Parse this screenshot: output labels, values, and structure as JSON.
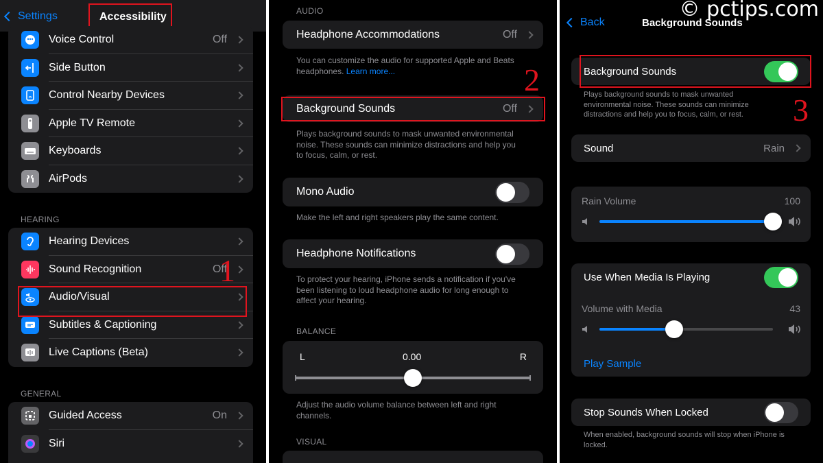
{
  "panel1": {
    "nav": {
      "back_label": "Settings",
      "title": "Accessibility"
    },
    "group_top": [
      {
        "label": "Voice Control",
        "value": "Off",
        "icon": "voice-control-icon",
        "color": "#0a84ff"
      },
      {
        "label": "Side Button",
        "value": "",
        "icon": "side-button-icon",
        "color": "#0a84ff"
      },
      {
        "label": "Control Nearby Devices",
        "value": "",
        "icon": "control-nearby-icon",
        "color": "#0a84ff"
      },
      {
        "label": "Apple TV Remote",
        "value": "",
        "icon": "tv-remote-icon",
        "color": "#8e8e93"
      },
      {
        "label": "Keyboards",
        "value": "",
        "icon": "keyboard-icon",
        "color": "#8e8e93"
      },
      {
        "label": "AirPods",
        "value": "",
        "icon": "airpods-icon",
        "color": "#8e8e93"
      }
    ],
    "hearing_header": "HEARING",
    "group_hearing": [
      {
        "label": "Hearing Devices",
        "value": "",
        "icon": "ear-icon",
        "color": "#0a84ff"
      },
      {
        "label": "Sound Recognition",
        "value": "Off",
        "icon": "sound-recognition-icon",
        "color": "#ff375f"
      },
      {
        "label": "Audio/Visual",
        "value": "",
        "icon": "audio-visual-icon",
        "color": "#0a84ff"
      },
      {
        "label": "Subtitles & Captioning",
        "value": "",
        "icon": "subtitles-icon",
        "color": "#0a84ff"
      },
      {
        "label": "Live Captions (Beta)",
        "value": "",
        "icon": "live-captions-icon",
        "color": "#8e8e93"
      }
    ],
    "general_header": "GENERAL",
    "group_general": [
      {
        "label": "Guided Access",
        "value": "On",
        "icon": "guided-access-icon",
        "color": "#636366"
      },
      {
        "label": "Siri",
        "value": "",
        "icon": "siri-icon",
        "color": "#3a3a3c"
      }
    ],
    "step": "1"
  },
  "panel2": {
    "audio_header": "AUDIO",
    "headphone_accommodations": {
      "label": "Headphone Accommodations",
      "value": "Off"
    },
    "accommodations_footer": "You can customize the audio for supported Apple and Beats headphones.",
    "learn_more": "Learn more...",
    "background_sounds": {
      "label": "Background Sounds",
      "value": "Off"
    },
    "background_footer": "Plays background sounds to mask unwanted environmental noise. These sounds can minimize distractions and help you to focus, calm, or rest.",
    "mono_audio": {
      "label": "Mono Audio",
      "on": false
    },
    "mono_footer": "Make the left and right speakers play the same content.",
    "headphone_notifications": {
      "label": "Headphone Notifications",
      "on": false
    },
    "notifications_footer": "To protect your hearing, iPhone sends a notification if you've been listening to loud headphone audio for long enough to affect your hearing.",
    "balance_header": "BALANCE",
    "balance": {
      "left": "L",
      "right": "R",
      "value_text": "0.00",
      "value": 0.5
    },
    "balance_footer": "Adjust the audio volume balance between left and right channels.",
    "visual_header": "VISUAL",
    "step": "2"
  },
  "panel3": {
    "nav": {
      "back_label": "Back",
      "title": "Background Sounds"
    },
    "watermark": "© pctips.com",
    "background_sounds": {
      "label": "Background Sounds",
      "on": true
    },
    "background_footer": "Plays background sounds to mask unwanted environmental noise. These sounds can minimize distractions and help you to focus, calm, or rest.",
    "sound": {
      "label": "Sound",
      "value": "Rain"
    },
    "rain_volume": {
      "label": "Rain Volume",
      "value_text": "100",
      "value": 1.0
    },
    "use_when_media": {
      "label": "Use When Media Is Playing",
      "on": true
    },
    "volume_with_media": {
      "label": "Volume with Media",
      "value_text": "43",
      "value": 0.43
    },
    "play_sample": "Play Sample",
    "stop_when_locked": {
      "label": "Stop Sounds When Locked",
      "on": false
    },
    "stop_footer": "When enabled, background sounds will stop when iPhone is locked.",
    "step": "3"
  },
  "colors": {
    "accent": "#0a84ff",
    "toggle_on": "#34c759",
    "highlight": "#e0141e",
    "cell": "#1c1c1e"
  }
}
